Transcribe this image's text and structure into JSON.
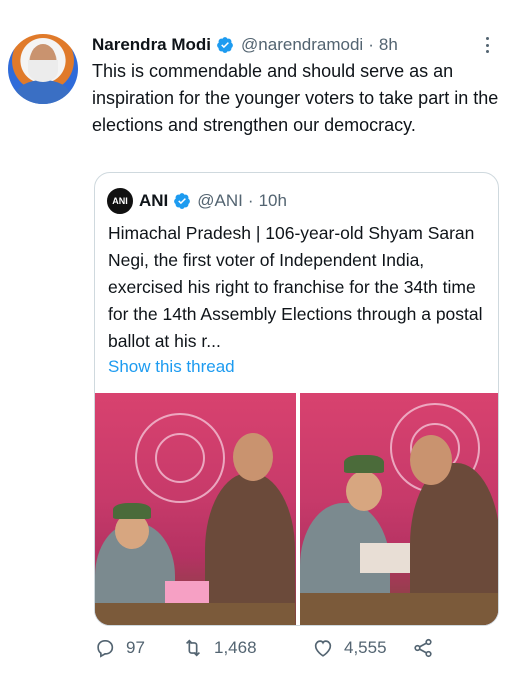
{
  "tweet": {
    "author_name": "Narendra Modi",
    "author_handle": "@narendramodi",
    "separator": "·",
    "time": "8h",
    "text": "This is commendable and should serve as an inspiration for the younger voters to take part in the elections and strengthen our democracy."
  },
  "quoted_tweet": {
    "logo_text": "ANI",
    "author_name": "ANI",
    "author_handle": "@ANI",
    "separator": "·",
    "time": "10h",
    "text": "Himachal Pradesh | 106-year-old Shyam Saran Negi, the first voter of Independent India, exercised his right to franchise for the 34th time for the 14th Assembly Elections through a postal ballot at his r...",
    "show_thread": "Show this thread"
  },
  "actions": {
    "replies": "97",
    "retweets": "1,468",
    "likes": "4,555"
  },
  "colors": {
    "accent": "#1d9bf0",
    "secondary_text": "#536471",
    "border": "#cfd9de"
  }
}
